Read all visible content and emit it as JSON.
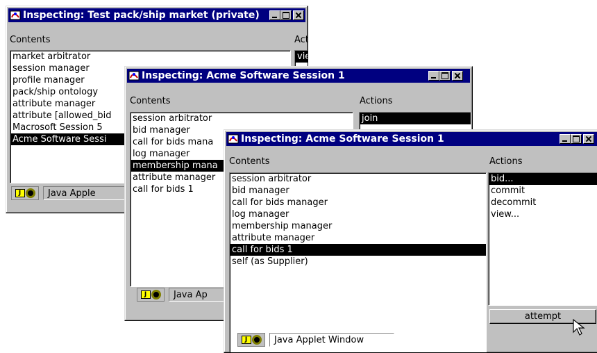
{
  "window1": {
    "title": "Inspecting: Test pack/ship market (private)",
    "contents_label": "Contents",
    "actions_label": "Actions",
    "contents": [
      "market arbitrator",
      "session manager",
      "profile manager",
      "pack/ship ontology",
      "attribute manager",
      "attribute [allowed_bid",
      "Macrosoft Session 5",
      "Acme Software Sessi"
    ],
    "selected_content": 7,
    "actions": [
      "view..."
    ],
    "selected_action": 0,
    "status": "Java Apple"
  },
  "window2": {
    "title": "Inspecting: Acme Software Session 1",
    "contents_label": "Contents",
    "actions_label": "Actions",
    "contents": [
      "session arbitrator",
      "bid manager",
      "call for bids mana",
      "log manager",
      "membership mana",
      "attribute manager",
      "call for bids 1"
    ],
    "selected_content": 4,
    "actions": [
      "join"
    ],
    "selected_action": 0,
    "status": "Java Ap"
  },
  "window3": {
    "title": "Inspecting: Acme Software Session 1",
    "contents_label": "Contents",
    "actions_label": "Actions",
    "contents": [
      "session arbitrator",
      "bid manager",
      "call for bids manager",
      "log manager",
      "membership manager",
      "attribute manager",
      "call for bids 1",
      "self (as Supplier)"
    ],
    "selected_content": 6,
    "actions": [
      "bid...",
      "commit",
      "decommit",
      "view..."
    ],
    "selected_action": 0,
    "attempt_label": "attempt",
    "status": "Java Applet Window"
  },
  "colors": {
    "titlebar": "#000080",
    "face": "#c0c0c0",
    "selection": "#000000"
  },
  "icons": [
    "java-applet-icon",
    "arrow-cursor-icon",
    "minimize-icon",
    "maximize-icon",
    "close-icon"
  ]
}
